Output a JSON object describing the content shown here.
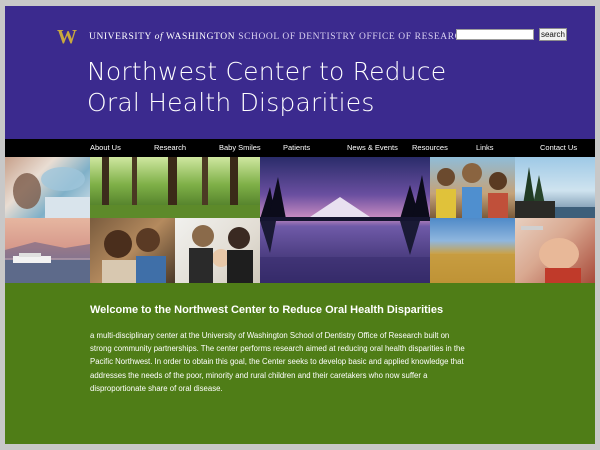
{
  "header": {
    "logo_letter": "W",
    "university": "UNIVERSITY",
    "of": "of",
    "washington": "WASHINGTON",
    "school_line": "SCHOOL OF DENTISTRY OFFICE OF RESEARCH",
    "title_line1": "Northwest Center to Reduce",
    "title_line2": "Oral Health Disparities",
    "background_color": "#3b2a8e",
    "logo_color": "#c9a93e"
  },
  "search": {
    "value": "",
    "button_label": "search"
  },
  "nav": {
    "items": [
      {
        "label": "About Us"
      },
      {
        "label": "Research"
      },
      {
        "label": "Baby Smiles"
      },
      {
        "label": "Patients"
      },
      {
        "label": "News & Events"
      },
      {
        "label": "Resources"
      },
      {
        "label": "Links"
      },
      {
        "label": "Contact Us"
      }
    ]
  },
  "photos": [
    {
      "subject": "dental-exam-photo"
    },
    {
      "subject": "forest-photo"
    },
    {
      "subject": "mountain-lake-sunset-photo"
    },
    {
      "subject": "children-smiling-photo"
    },
    {
      "subject": "coastal-trees-photo"
    },
    {
      "subject": "ferry-sunset-photo"
    },
    {
      "subject": "grandmother-and-child-photo"
    },
    {
      "subject": "family-with-baby-photo"
    },
    {
      "subject": "wheat-field-photo"
    },
    {
      "subject": "child-dental-visit-photo"
    }
  ],
  "main": {
    "welcome_heading": "Welcome to the Northwest Center to Reduce Oral Health Disparities",
    "description": "a multi-disciplinary center at the University of Washington School of Dentistry Office of Research built on strong community partnerships. The center performs research aimed at reducing oral health disparities in the Pacific Northwest. In order to obtain this goal, the Center seeks to develop basic and applied knowledge that addresses the needs of the poor, minority and rural children and their caretakers who now suffer a disproportionate share of oral disease.",
    "background_color": "#4f7d17"
  }
}
